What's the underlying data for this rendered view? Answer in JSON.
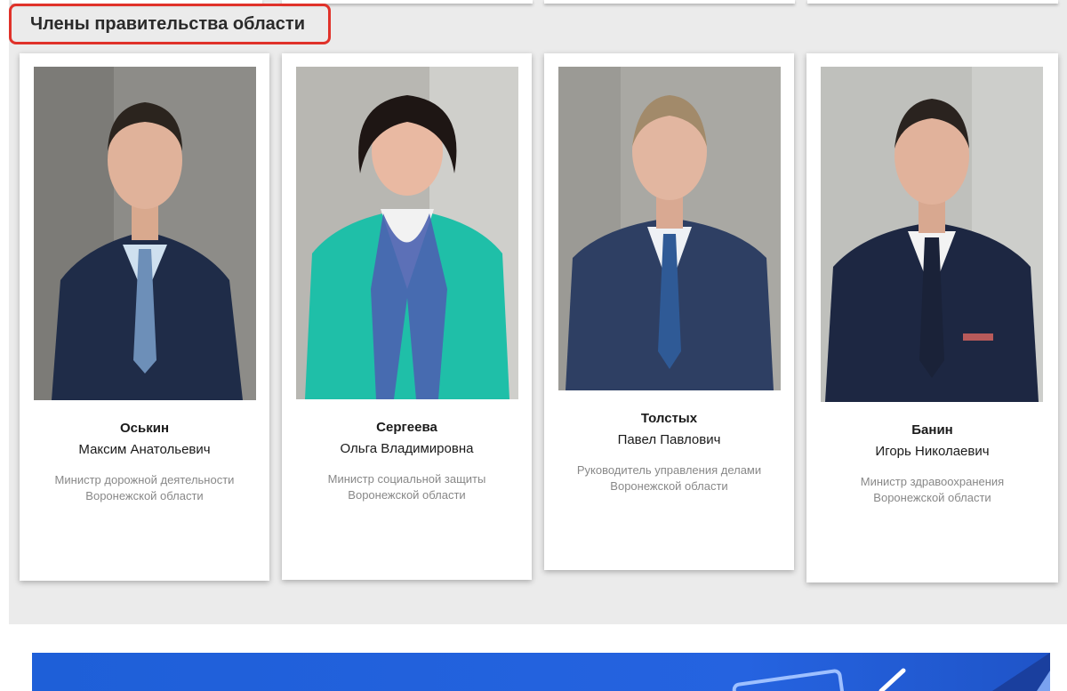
{
  "section": {
    "title": "Члены правительства области"
  },
  "members": [
    {
      "surname": "Оськин",
      "given_names": "Максим Анатольевич",
      "position_line1": "Министр дорожной деятельности",
      "position_line2": "Воронежской области"
    },
    {
      "surname": "Сергеева",
      "given_names": "Ольга Владимировна",
      "position_line1": "Министр социальной защиты",
      "position_line2": "Воронежской области"
    },
    {
      "surname": "Толстых",
      "given_names": "Павел Павлович",
      "position_line1": "Руководитель управления делами",
      "position_line2": "Воронежской области"
    },
    {
      "surname": "Банин",
      "given_names": "Игорь Николаевич",
      "position_line1": "Министр здравоохранения",
      "position_line2": "Воронежской области"
    }
  ],
  "colors": {
    "section_bg": "#ebebeb",
    "title_border": "#e0322a",
    "banner_blue": "#2563e0",
    "position_text": "#888888"
  }
}
